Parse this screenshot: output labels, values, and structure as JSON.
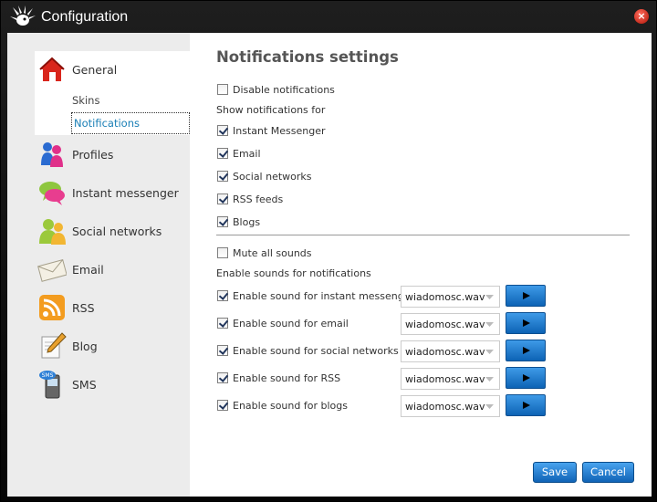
{
  "window": {
    "title": "Configuration",
    "close_icon": "close-icon"
  },
  "sidebar": {
    "items": [
      {
        "label": "General",
        "icon": "home-icon"
      },
      {
        "label": "Profiles",
        "icon": "profiles-icon"
      },
      {
        "label": "Instant messenger",
        "icon": "chat-bubbles-icon"
      },
      {
        "label": "Social networks",
        "icon": "people-icon"
      },
      {
        "label": "Email",
        "icon": "envelope-icon"
      },
      {
        "label": "RSS",
        "icon": "rss-icon"
      },
      {
        "label": "Blog",
        "icon": "pencil-note-icon"
      },
      {
        "label": "SMS",
        "icon": "phone-sms-icon"
      }
    ],
    "general_subitems": [
      {
        "label": "Skins",
        "active": false
      },
      {
        "label": "Notifications",
        "active": true
      }
    ]
  },
  "content": {
    "heading": "Notifications settings",
    "disable_notifications": {
      "label": "Disable notifications",
      "checked": false
    },
    "show_for_label": "Show notifications for",
    "show_for": [
      {
        "label": "Instant Messenger",
        "checked": true
      },
      {
        "label": "Email",
        "checked": true
      },
      {
        "label": "Social networks",
        "checked": true
      },
      {
        "label": "RSS feeds",
        "checked": true
      },
      {
        "label": "Blogs",
        "checked": true
      }
    ],
    "mute_all": {
      "label": "Mute all sounds",
      "checked": false
    },
    "sounds_label": "Enable sounds for notifications",
    "sounds": [
      {
        "label": "Enable sound for instant messenger",
        "checked": true,
        "file": "wiadomosc.wav"
      },
      {
        "label": "Enable sound for email",
        "checked": true,
        "file": "wiadomosc.wav"
      },
      {
        "label": "Enable sound for social networks",
        "checked": true,
        "file": "wiadomosc.wav"
      },
      {
        "label": "Enable sound for RSS",
        "checked": true,
        "file": "wiadomosc.wav"
      },
      {
        "label": "Enable sound for blogs",
        "checked": true,
        "file": "wiadomosc.wav"
      }
    ]
  },
  "footer": {
    "save_label": "Save",
    "cancel_label": "Cancel"
  },
  "colors": {
    "accent": "#1a7fb6",
    "button": "#1063b6"
  }
}
